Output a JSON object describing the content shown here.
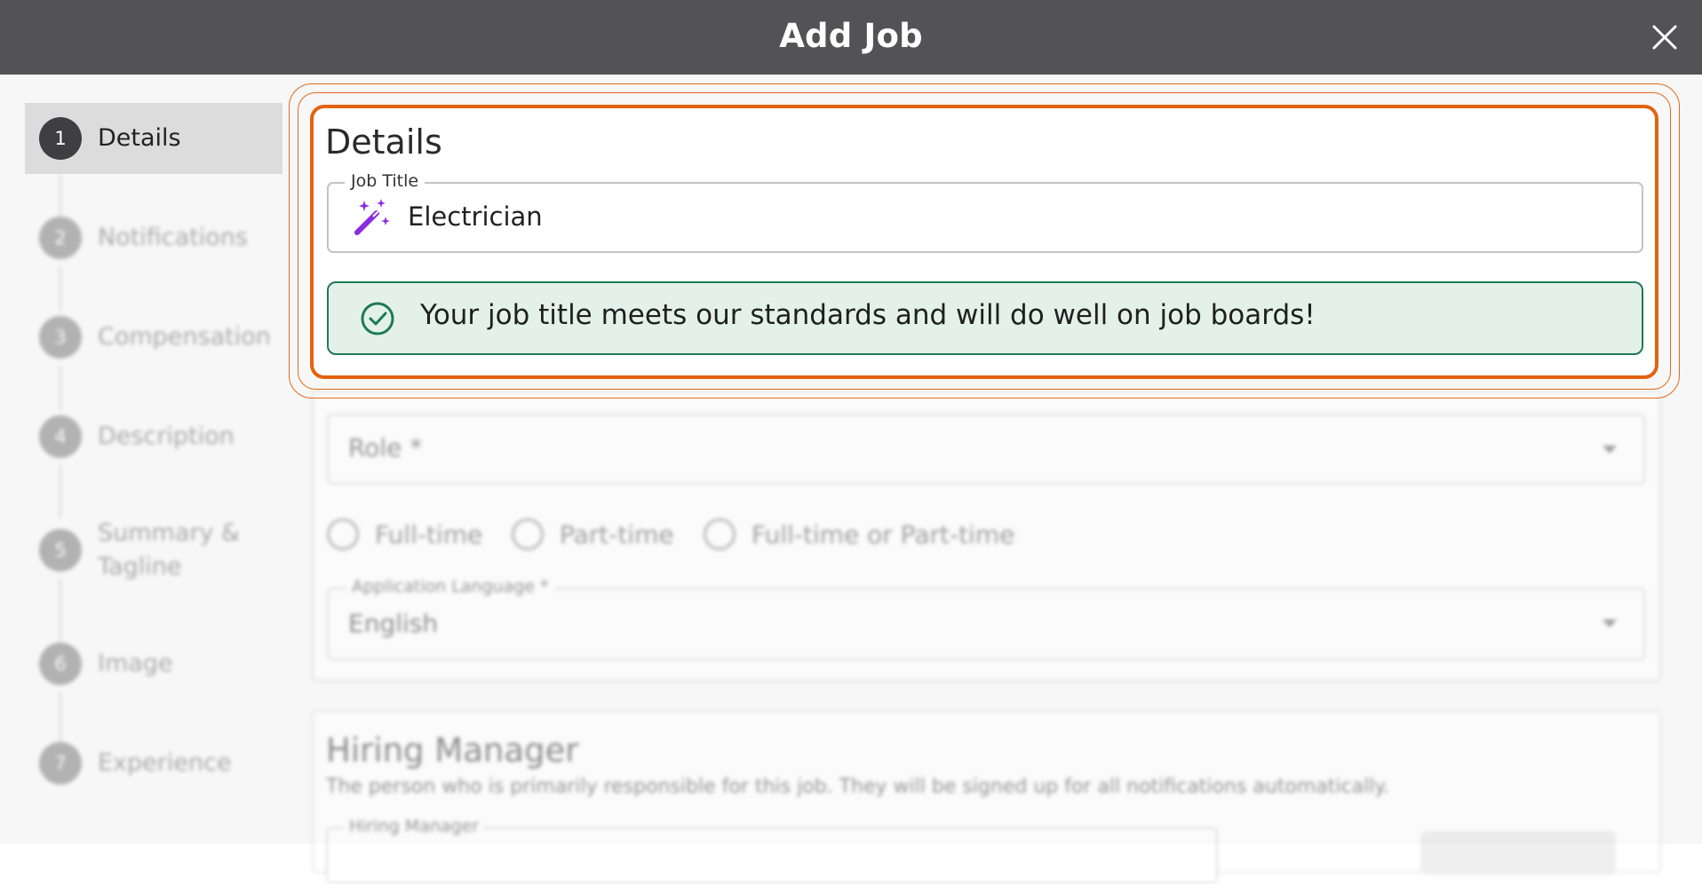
{
  "dialog": {
    "title": "Add Job",
    "close_icon": "close-icon"
  },
  "steps": [
    {
      "number": "1",
      "label": "Details",
      "active": true
    },
    {
      "number": "2",
      "label": "Notifications"
    },
    {
      "number": "3",
      "label": "Compensation"
    },
    {
      "number": "4",
      "label": "Description"
    },
    {
      "number": "5",
      "label": "Summary & Tagline"
    },
    {
      "number": "6",
      "label": "Image"
    },
    {
      "number": "7",
      "label": "Experience"
    }
  ],
  "details": {
    "heading": "Details",
    "job_title_label": "Job Title",
    "job_title_value": "Electrician",
    "job_title_icon": "magic-wand-icon",
    "alert_icon": "check-circle-icon",
    "alert_text": "Your job title meets our standards and will do well on job boards!"
  },
  "form": {
    "role_label": "Role *",
    "employment_types": [
      "Full-time",
      "Part-time",
      "Full-time or Part-time"
    ],
    "application_language_label": "Application Language *",
    "application_language_value": "English"
  },
  "hiring_manager": {
    "heading": "Hiring Manager",
    "description": "The person who is primarily responsible for this job. They will be signed up for all notifications automatically.",
    "field_label": "Hiring Manager"
  },
  "colors": {
    "header_bg": "#535257",
    "highlight": "#e3630f",
    "success_bg": "#e4f1eb",
    "success_border": "#1e7a55",
    "wand_purple": "#8a2be2"
  }
}
